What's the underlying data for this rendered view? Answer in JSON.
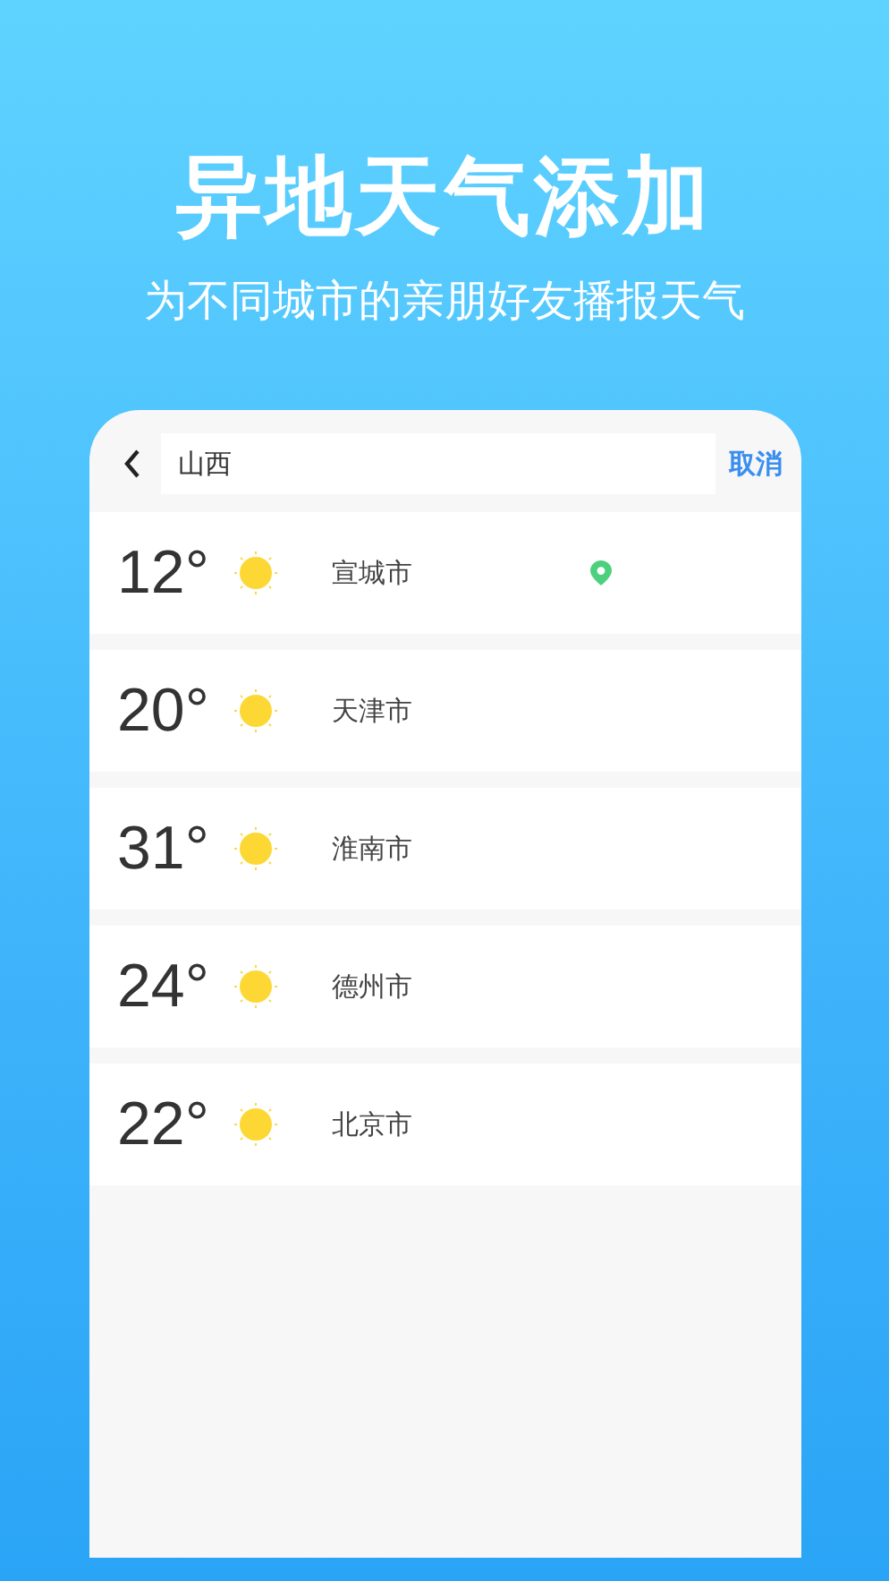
{
  "headline": "异地天气添加",
  "subheadline": "为不同城市的亲朋好友播报天气",
  "search": {
    "value": "山西",
    "cancel": "取消"
  },
  "cities": [
    {
      "temp": "12°",
      "kind": "sunny",
      "name": "宣城市",
      "located": true
    },
    {
      "temp": "20°",
      "kind": "sunny",
      "name": "天津市",
      "located": false
    },
    {
      "temp": "31°",
      "kind": "sunny",
      "name": "淮南市",
      "located": false
    },
    {
      "temp": "24°",
      "kind": "sunny",
      "name": "德州市",
      "located": false
    },
    {
      "temp": "22°",
      "kind": "sunny",
      "name": "北京市",
      "located": false
    }
  ]
}
